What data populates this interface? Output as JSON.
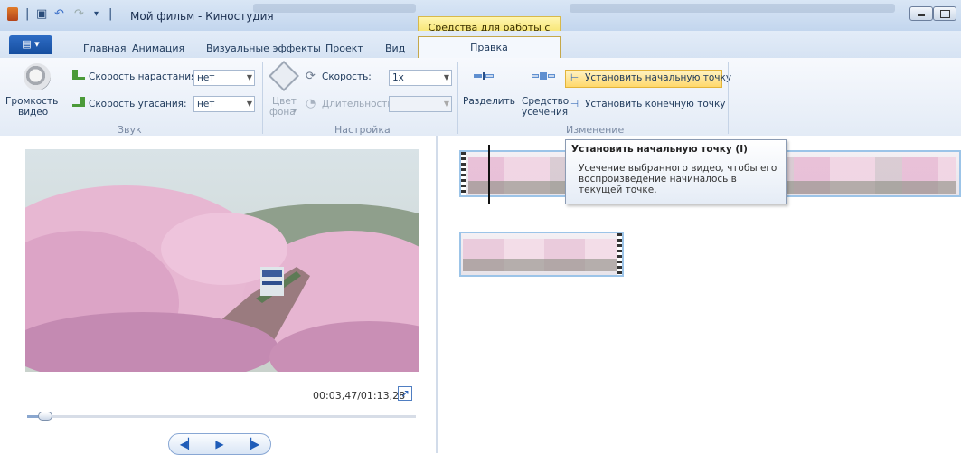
{
  "window": {
    "title": "Мой фильм - Киностудия",
    "context_tab_title": "Средства для работы с видео"
  },
  "tabs": {
    "file": "",
    "items": [
      "Главная",
      "Анимация",
      "Визуальные эффекты",
      "Проект",
      "Вид"
    ],
    "edit": "Правка"
  },
  "ribbon": {
    "sound": {
      "volume_label_1": "Громкость",
      "volume_label_2": "видео",
      "fade_in_label": "Скорость нарастания:",
      "fade_in_value": "нет",
      "fade_out_label": "Скорость угасания:",
      "fade_out_value": "нет",
      "group_label": "Звук"
    },
    "adjust": {
      "bg_color_label_1": "Цвет",
      "bg_color_label_2": "фона",
      "speed_label": "Скорость:",
      "speed_value": "1x",
      "duration_label": "Длительность:",
      "duration_value": "",
      "group_label": "Настройка"
    },
    "edit": {
      "split_label": "Разделить",
      "trim_label_1": "Средство",
      "trim_label_2": "усечения",
      "set_start_label": "Установить начальную точку",
      "set_end_label": "Установить конечную точку",
      "group_label": "Изменение"
    }
  },
  "tooltip": {
    "title": "Установить начальную точку (I)",
    "body": "Усечение выбранного видео, чтобы его воспроизведение начиналось в текущей точке."
  },
  "preview": {
    "time": "00:03,47/01:13,28",
    "progress_fraction": 0.047
  },
  "colors": {
    "accent": "#2b63b8",
    "context_tab": "#f4df5e",
    "highlight": "#ffd86b"
  }
}
